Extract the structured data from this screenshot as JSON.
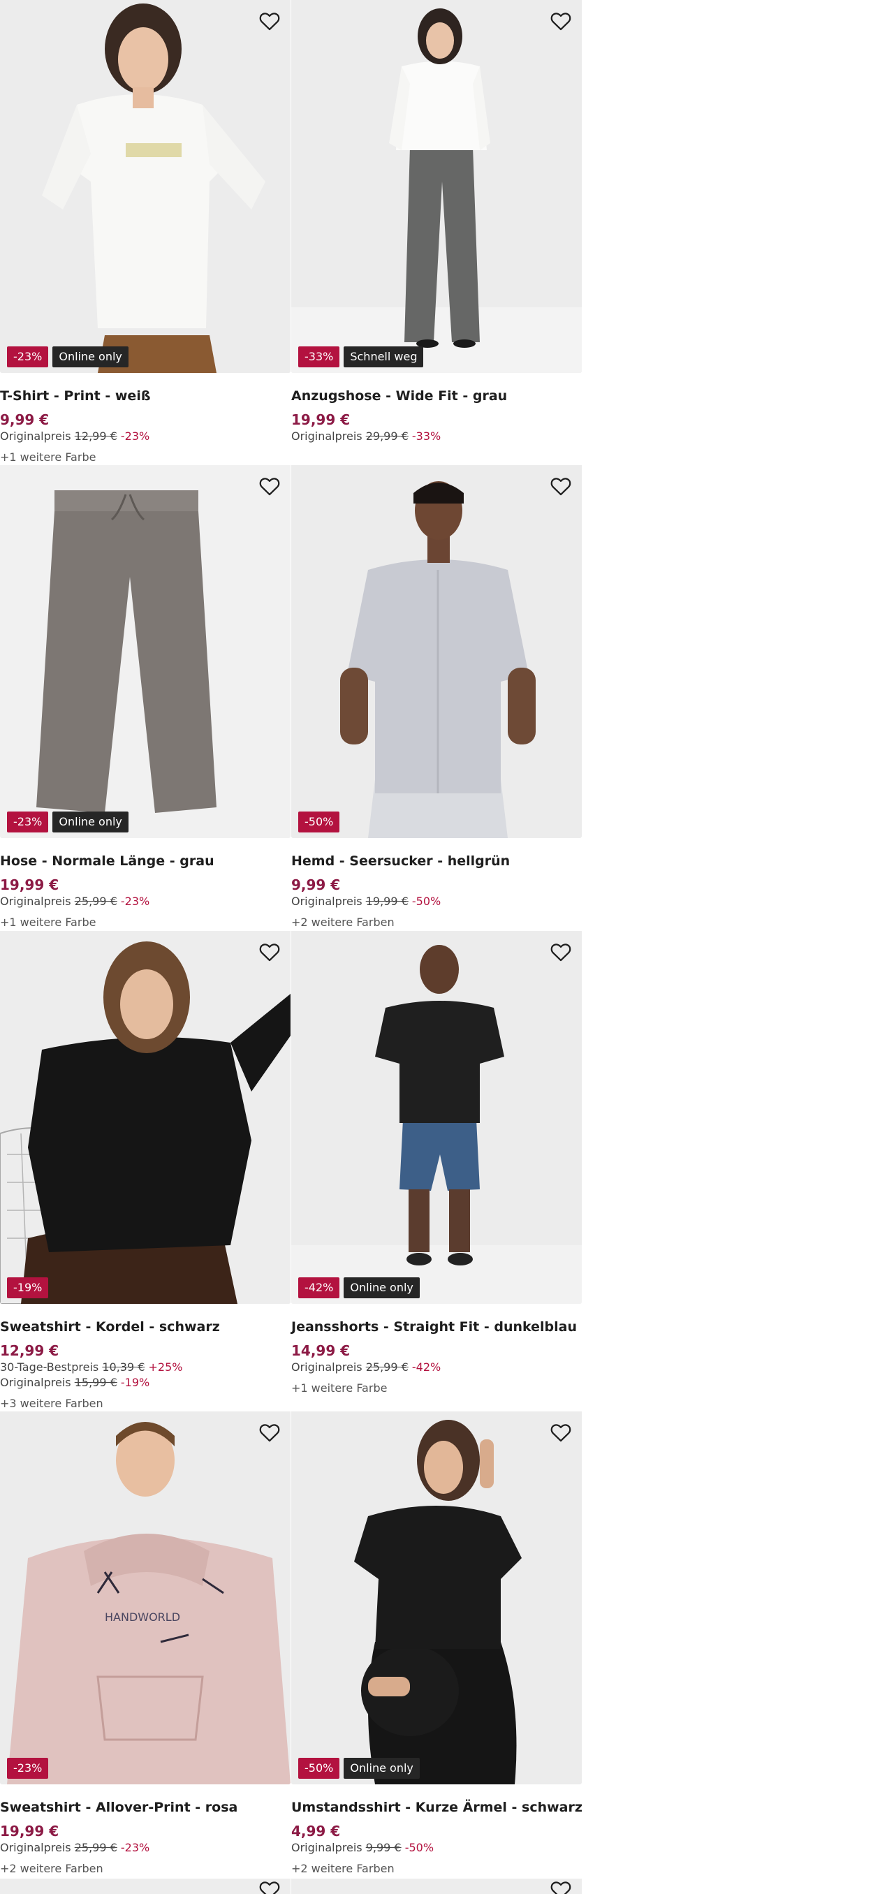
{
  "labels": {
    "original_price": "Originalpreis",
    "thirty_day_price": "30-Tage-Bestpreis"
  },
  "products": [
    {
      "title": "T-Shirt - Print - weiß",
      "price": "9,99 €",
      "discount_badge": "-23%",
      "tag": "Online only",
      "original_price": "12,99 €",
      "original_pct": "-23%",
      "colors_text": "+1 weitere Farbe",
      "image": "woman-white-tshirt",
      "bg": "#ececec"
    },
    {
      "title": "Anzugshose - Wide Fit - grau",
      "price": "19,99 €",
      "discount_badge": "-33%",
      "tag": "Schnell weg",
      "original_price": "29,99 €",
      "original_pct": "-33%",
      "colors_text": "",
      "image": "woman-grey-trousers",
      "bg": "#ebebeb"
    },
    {
      "title": "Hose - Normale Länge - grau",
      "price": "19,99 €",
      "discount_badge": "-23%",
      "tag": "Online only",
      "original_price": "25,99 €",
      "original_pct": "-23%",
      "colors_text": "+1 weitere Farbe",
      "image": "grey-pants-flat",
      "bg": "#f1f1f1"
    },
    {
      "title": "Hemd - Seersucker - hellgrün",
      "price": "9,99 €",
      "discount_badge": "-50%",
      "tag": "",
      "original_price": "19,99 €",
      "original_pct": "-50%",
      "colors_text": "+2 weitere Farben",
      "image": "man-seersucker-shirt",
      "bg": "#ececec"
    },
    {
      "title": "Sweatshirt - Kordel - schwarz",
      "price": "12,99 €",
      "discount_badge": "-19%",
      "tag": "",
      "thirty_day_price": "10,39 €",
      "thirty_day_pct": "+25%",
      "original_price": "15,99 €",
      "original_pct": "-19%",
      "colors_text": "+3 weitere Farben",
      "image": "woman-black-sweatshirt",
      "bg": "#ececec"
    },
    {
      "title": "Jeansshorts - Straight Fit - dunkelblau",
      "price": "14,99 €",
      "discount_badge": "-42%",
      "tag": "Online only",
      "original_price": "25,99 €",
      "original_pct": "-42%",
      "colors_text": "+1 weitere Farbe",
      "image": "man-denim-shorts",
      "bg": "#ebebeb"
    },
    {
      "title": "Sweatshirt - Allover-Print - rosa",
      "price": "19,99 €",
      "discount_badge": "-23%",
      "tag": "",
      "original_price": "25,99 €",
      "original_pct": "-23%",
      "colors_text": "+2 weitere Farben",
      "image": "man-pink-hoodie",
      "bg": "#ececec"
    },
    {
      "title": "Umstandsshirt - Kurze Ärmel - schwarz",
      "price": "4,99 €",
      "discount_badge": "-50%",
      "tag": "Online only",
      "original_price": "9,99 €",
      "original_pct": "-50%",
      "colors_text": "+2 weitere Farben",
      "image": "pregnant-woman-black-shirt",
      "bg": "#ececec"
    }
  ],
  "colors": {
    "price": "#8c1a45",
    "discount_badge": "#b3123f",
    "tag_badge": "#262626",
    "text": "#1e1e1e"
  },
  "icons": {
    "favorite": "heart-outline-icon"
  }
}
